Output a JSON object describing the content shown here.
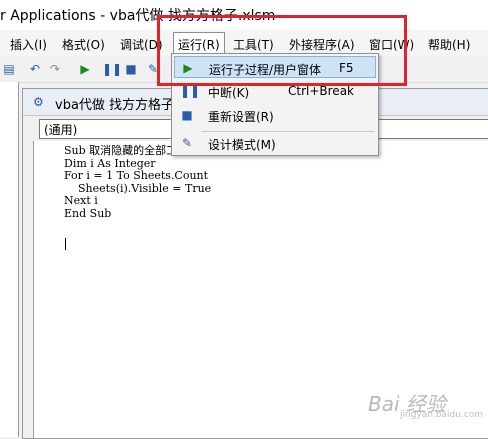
{
  "window": {
    "title": "r Applications - vba代做 找方方格子.xlsm"
  },
  "menubar": {
    "items": [
      {
        "label": "插入(I)"
      },
      {
        "label": "格式(O)"
      },
      {
        "label": "调试(D)"
      },
      {
        "label": "运行(R)"
      },
      {
        "label": "工具(T)"
      },
      {
        "label": "外接程序(A)"
      },
      {
        "label": "窗口(W)"
      },
      {
        "label": "帮助(H)"
      }
    ]
  },
  "run_menu": {
    "items": [
      {
        "label": "运行子过程/用户窗体",
        "shortcut": "F5",
        "icon": "play-icon"
      },
      {
        "label": "中断(K)",
        "shortcut": "Ctrl+Break",
        "icon": "pause-icon"
      },
      {
        "label": "重新设置(R)",
        "shortcut": "",
        "icon": "stop-icon"
      },
      {
        "label": "设计模式(M)",
        "shortcut": "",
        "icon": "design-mode-icon"
      }
    ]
  },
  "code_window": {
    "title": "vba代做 找方方格子.x",
    "object_combo": "(通用)",
    "code": "Sub 取消隐藏的全部工作表()\nDim i As Integer\nFor i = 1 To Sheets.Count\n    Sheets(i).Visible = True\nNext i\nEnd Sub"
  },
  "watermark": {
    "text": "Bai 经验",
    "sub": "jingyan.baidu.com"
  },
  "colors": {
    "highlight": "#e0242d",
    "selection": "#cfe3f7"
  }
}
